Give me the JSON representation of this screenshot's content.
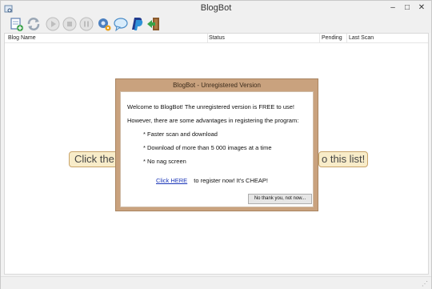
{
  "window": {
    "title": "BlogBot",
    "minimize_glyph": "–",
    "maximize_glyph": "□",
    "close_glyph": "✕"
  },
  "toolbar": {
    "buttons": [
      {
        "icon": "add-blog-icon"
      },
      {
        "icon": "refresh-icon"
      },
      {
        "icon": "play-icon"
      },
      {
        "icon": "stop-icon"
      },
      {
        "icon": "pause-icon"
      },
      {
        "icon": "settings-icon"
      },
      {
        "icon": "chat-icon"
      },
      {
        "icon": "paypal-icon"
      },
      {
        "icon": "exit-icon"
      }
    ]
  },
  "list": {
    "columns": [
      "Blog Name",
      "Status",
      "Pending",
      "Last Scan"
    ],
    "hint_left": "Click the",
    "hint_right": "o this list!"
  },
  "dialog": {
    "title": "BlogBot - Unregistered Version",
    "welcome": "Welcome to BlogBot! The unregistered version is FREE to use!",
    "advantages": "However, there are some advantages in registering the program:",
    "bullet1": "* Faster scan and download",
    "bullet2": "* Download of more than 5 000 images at a time",
    "bullet3": "* No nag screen",
    "register_link": "Click HERE",
    "register_text": "to register now! It's CHEAP!",
    "no_thanks": "No thank you, not now..."
  },
  "colors": {
    "dialog_frame": "#c9a27e",
    "link": "#1a35b8",
    "hint_bg": "#f8ecc9"
  }
}
